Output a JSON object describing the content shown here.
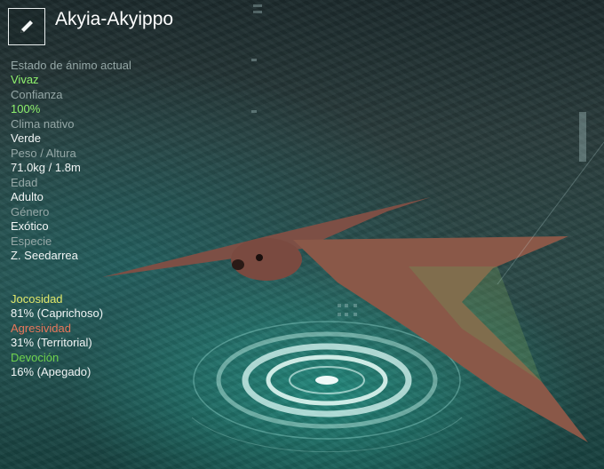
{
  "pal": {
    "name": "Akyia-Akyippo",
    "edit_icon": "pencil-icon"
  },
  "stats": [
    {
      "label": "Estado de ánimo actual",
      "value": "Vivaz"
    },
    {
      "label": "Confianza",
      "value": "100%"
    },
    {
      "label": "Clima nativo",
      "value": "Verde"
    },
    {
      "label": "Peso / Altura",
      "value": "71.0kg / 1.8m"
    },
    {
      "label": "Edad",
      "value": "Adulto"
    },
    {
      "label": "Género",
      "value": "Exótico"
    },
    {
      "label": "Especie",
      "value": "Z. Seedarrea"
    }
  ],
  "traits": [
    {
      "label": "Jocosidad",
      "value": "81% (Caprichoso)",
      "color": "#e2e86a"
    },
    {
      "label": "Agresividad",
      "value": "31% (Territorial)",
      "color": "#e8765a"
    },
    {
      "label": "Devoción",
      "value": "16% (Apegado)",
      "color": "#6fd44e"
    }
  ],
  "colors": {
    "accent_green": "#8ff26d",
    "label_gray": "#95a7a6"
  }
}
